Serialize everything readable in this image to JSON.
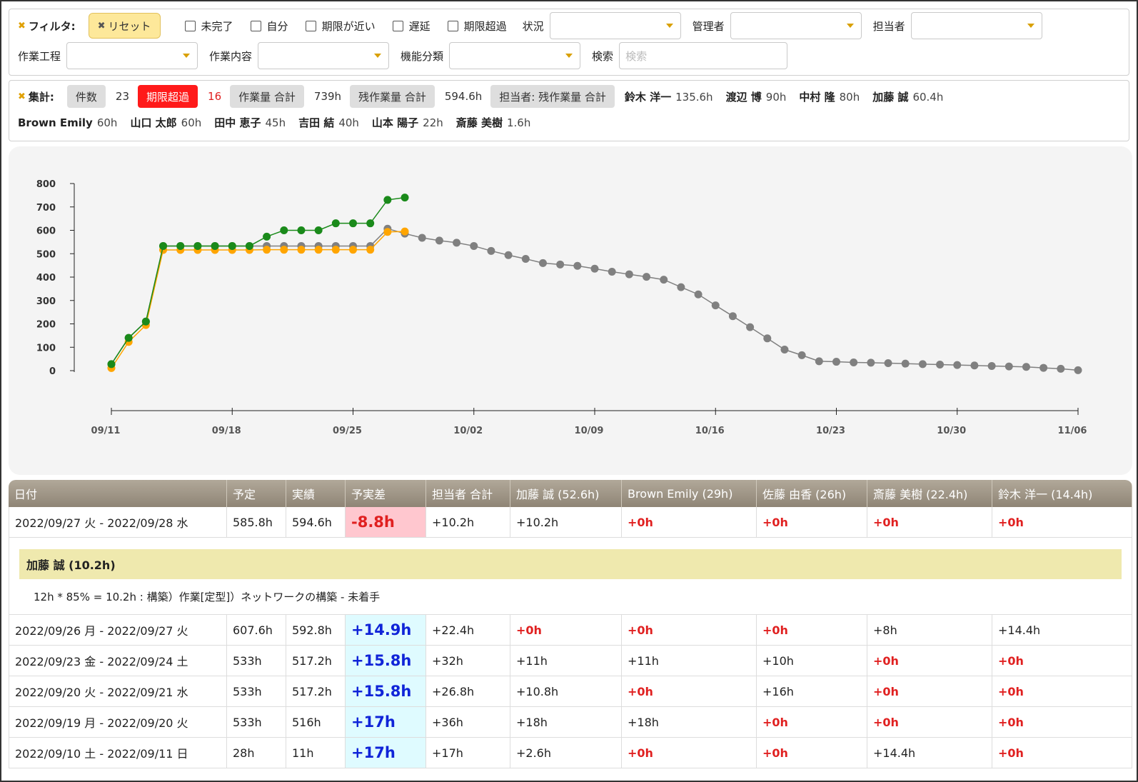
{
  "filter": {
    "title": "フィルタ:",
    "reset_label": "リセット",
    "checkboxes": [
      "未完了",
      "自分",
      "期限が近い",
      "遅延",
      "期限超過"
    ],
    "labels": {
      "status": "状況",
      "manager": "管理者",
      "assignee": "担当者",
      "process": "作業工程",
      "content": "作業内容",
      "function": "機能分類",
      "search": "検索"
    },
    "search_placeholder": "検索"
  },
  "summary": {
    "title": "集計:",
    "count_label": "件数",
    "count_value": "23",
    "overdue_label": "期限超過",
    "overdue_value": "16",
    "total_label": "作業量 合計",
    "total_value": "739h",
    "remaining_label": "残作業量 合計",
    "remaining_value": "594.6h",
    "per_person_label": "担当者: 残作業量 合計",
    "people": [
      {
        "name": "鈴木 洋一",
        "hours": "135.6h"
      },
      {
        "name": "渡辺 博",
        "hours": "90h"
      },
      {
        "name": "中村 隆",
        "hours": "80h"
      },
      {
        "name": "加藤 誠",
        "hours": "60.4h"
      },
      {
        "name": "Brown Emily",
        "hours": "60h"
      },
      {
        "name": "山口 太郎",
        "hours": "60h"
      },
      {
        "name": "田中 恵子",
        "hours": "45h"
      },
      {
        "name": "吉田 結",
        "hours": "40h"
      },
      {
        "name": "山本 陽子",
        "hours": "22h"
      },
      {
        "name": "斎藤 美樹",
        "hours": "1.6h"
      }
    ]
  },
  "chart_data": {
    "type": "line",
    "title": "",
    "xlabel": "",
    "ylabel": "",
    "ylim": [
      0,
      800
    ],
    "yticks": [
      0,
      100,
      200,
      300,
      400,
      500,
      600,
      700,
      800
    ],
    "xtick_labels": [
      "09/11",
      "09/18",
      "09/25",
      "10/02",
      "10/09",
      "10/16",
      "10/23",
      "10/30",
      "11/06"
    ],
    "x_start": "2022-09-11",
    "colors": {
      "green": "#1a8a1a",
      "orange": "#ffa500",
      "gray": "#808080"
    },
    "series": [
      {
        "color": "green",
        "x": [
          "2022-09-11",
          "2022-09-12",
          "2022-09-13",
          "2022-09-14",
          "2022-09-15",
          "2022-09-16",
          "2022-09-17",
          "2022-09-18",
          "2022-09-19",
          "2022-09-20",
          "2022-09-21",
          "2022-09-22",
          "2022-09-23",
          "2022-09-24",
          "2022-09-25",
          "2022-09-26",
          "2022-09-27",
          "2022-09-28"
        ],
        "values": [
          28,
          140,
          210,
          533,
          533,
          533,
          533,
          533,
          533,
          573,
          600,
          600,
          600,
          630,
          630,
          630,
          730,
          740
        ]
      },
      {
        "color": "orange",
        "x": [
          "2022-09-11",
          "2022-09-12",
          "2022-09-13",
          "2022-09-14",
          "2022-09-15",
          "2022-09-16",
          "2022-09-17",
          "2022-09-18",
          "2022-09-19",
          "2022-09-20",
          "2022-09-21",
          "2022-09-22",
          "2022-09-23",
          "2022-09-24",
          "2022-09-25",
          "2022-09-26",
          "2022-09-27",
          "2022-09-28"
        ],
        "values": [
          11,
          123,
          195,
          516,
          516,
          516,
          516,
          516,
          516,
          517,
          517,
          517,
          517,
          517,
          517,
          517,
          593,
          595
        ]
      },
      {
        "color": "gray",
        "x": [
          "2022-09-11",
          "2022-09-12",
          "2022-09-13",
          "2022-09-14",
          "2022-09-15",
          "2022-09-16",
          "2022-09-17",
          "2022-09-18",
          "2022-09-19",
          "2022-09-20",
          "2022-09-21",
          "2022-09-22",
          "2022-09-23",
          "2022-09-24",
          "2022-09-25",
          "2022-09-26",
          "2022-09-27",
          "2022-09-28",
          "2022-09-29",
          "2022-09-30",
          "2022-10-01",
          "2022-10-02",
          "2022-10-03",
          "2022-10-04",
          "2022-10-05",
          "2022-10-06",
          "2022-10-07",
          "2022-10-08",
          "2022-10-09",
          "2022-10-10",
          "2022-10-11",
          "2022-10-12",
          "2022-10-13",
          "2022-10-14",
          "2022-10-15",
          "2022-10-16",
          "2022-10-17",
          "2022-10-18",
          "2022-10-19",
          "2022-10-20",
          "2022-10-21",
          "2022-10-22",
          "2022-10-23",
          "2022-10-24",
          "2022-10-25",
          "2022-10-26",
          "2022-10-27",
          "2022-10-28",
          "2022-10-29",
          "2022-10-30",
          "2022-10-31",
          "2022-11-01",
          "2022-11-02",
          "2022-11-03",
          "2022-11-04",
          "2022-11-05",
          "2022-11-06"
        ],
        "values": [
          28,
          140,
          210,
          533,
          533,
          533,
          533,
          533,
          533,
          533,
          533,
          533,
          533,
          533,
          533,
          533,
          607,
          586,
          568,
          556,
          547,
          533,
          512,
          494,
          478,
          460,
          454,
          448,
          436,
          423,
          412,
          401,
          389,
          357,
          326,
          279,
          233,
          186,
          138,
          90,
          66,
          40,
          38,
          35,
          34,
          32,
          30,
          28,
          26,
          24,
          22,
          20,
          18,
          16,
          12,
          8,
          2
        ]
      }
    ]
  },
  "table": {
    "headers": [
      "日付",
      "予定",
      "実績",
      "予実差",
      "担当者 合計",
      "加藤 誠 (52.6h)",
      "Brown Emily (29h)",
      "佐藤 由香 (26h)",
      "斎藤 美樹 (22.4h)",
      "鈴木 洋一 (14.4h)"
    ],
    "first_row": {
      "date": "2022/09/27 火 - 2022/09/28 水",
      "plan": "585.8h",
      "actual": "594.6h",
      "diff": "-8.8h",
      "total": "+10.2h",
      "p1": "+10.2h",
      "p2": "+0h",
      "p3": "+0h",
      "p4": "+0h",
      "p5": "+0h"
    },
    "detail": {
      "header": "加藤 誠 (10.2h)",
      "text": "12h * 85% = 10.2h : 構築）作業[定型]）ネットワークの構築 - 未着手"
    },
    "rows": [
      {
        "date": "2022/09/26 月 - 2022/09/27 火",
        "plan": "607.6h",
        "actual": "592.8h",
        "diff": "+14.9h",
        "total": "+22.4h",
        "p1": "+0h",
        "p2": "+0h",
        "p3": "+0h",
        "p4": "+8h",
        "p5": "+14.4h"
      },
      {
        "date": "2022/09/23 金 - 2022/09/24 土",
        "plan": "533h",
        "actual": "517.2h",
        "diff": "+15.8h",
        "total": "+32h",
        "p1": "+11h",
        "p2": "+11h",
        "p3": "+10h",
        "p4": "+0h",
        "p5": "+0h"
      },
      {
        "date": "2022/09/20 火 - 2022/09/21 水",
        "plan": "533h",
        "actual": "517.2h",
        "diff": "+15.8h",
        "total": "+26.8h",
        "p1": "+10.8h",
        "p2": "+0h",
        "p3": "+16h",
        "p4": "+0h",
        "p5": "+0h"
      },
      {
        "date": "2022/09/19 月 - 2022/09/20 火",
        "plan": "533h",
        "actual": "516h",
        "diff": "+17h",
        "total": "+36h",
        "p1": "+18h",
        "p2": "+18h",
        "p3": "+0h",
        "p4": "+0h",
        "p5": "+0h"
      },
      {
        "date": "2022/09/10 土 - 2022/09/11 日",
        "plan": "28h",
        "actual": "11h",
        "diff": "+17h",
        "total": "+17h",
        "p1": "+2.6h",
        "p2": "+0h",
        "p3": "+0h",
        "p4": "+14.4h",
        "p5": "+0h"
      }
    ]
  }
}
